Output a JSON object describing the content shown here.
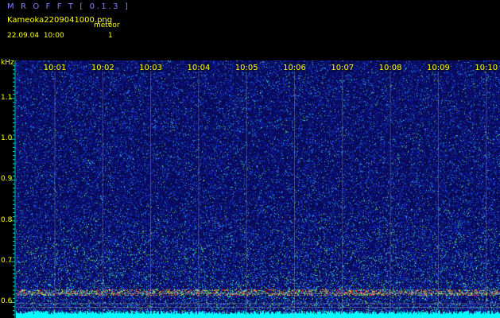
{
  "header": {
    "app_title": "M R O F F T [ 0.1.3 ]",
    "file_name": "Kameoka2209041000.png",
    "meteor_label": "meteor",
    "date": "22.09.04",
    "time": "10:00",
    "meteor_count": "1"
  },
  "axis": {
    "unit": "kHz",
    "y_ticks": [
      {
        "value": 1.1,
        "label": "1.1"
      },
      {
        "value": 1.0,
        "label": "1.0"
      },
      {
        "value": 0.9,
        "label": "0.9"
      },
      {
        "value": 0.8,
        "label": "0.8"
      },
      {
        "value": 0.7,
        "label": "0.7"
      },
      {
        "value": 0.6,
        "label": "0.6"
      }
    ],
    "x_ticks": [
      "10:01",
      "10:02",
      "10:03",
      "10:04",
      "10:05",
      "10:06",
      "10:07",
      "10:08",
      "10:09",
      "10:10"
    ]
  },
  "colors": {
    "background": "#000000",
    "title": "#8080ff",
    "header_text": "#ffff00",
    "axis": "#00c8c8",
    "grid": "#a0a0a0",
    "meteor_band": "#ff3030",
    "noise_floor": "#00ffff"
  }
}
